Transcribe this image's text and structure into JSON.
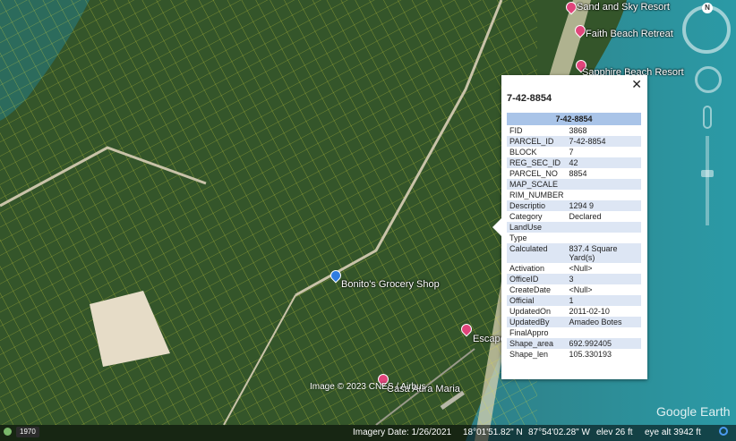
{
  "places": [
    {
      "name": "Sand and Sky Resort"
    },
    {
      "name": "Faith Beach Retreat"
    },
    {
      "name": "Sapphire Beach Resort"
    },
    {
      "name": "Bonito's Grocery Shop"
    },
    {
      "name": "Escape"
    },
    {
      "name": "Casa Aura Maria"
    }
  ],
  "popup": {
    "title": "7-42-8854",
    "close_symbol": "✕",
    "table_header": "7-42-8854",
    "rows": [
      {
        "k": "FID",
        "v": "3868"
      },
      {
        "k": "PARCEL_ID",
        "v": "7-42-8854"
      },
      {
        "k": "BLOCK",
        "v": "7"
      },
      {
        "k": "REG_SEC_ID",
        "v": "42"
      },
      {
        "k": "PARCEL_NO",
        "v": "8854"
      },
      {
        "k": "MAP_SCALE",
        "v": ""
      },
      {
        "k": "RIM_NUMBER",
        "v": ""
      },
      {
        "k": "Descriptio",
        "v": "1294 9"
      },
      {
        "k": "Category",
        "v": "Declared"
      },
      {
        "k": "LandUse",
        "v": ""
      },
      {
        "k": "Type",
        "v": ""
      },
      {
        "k": "Calculated",
        "v": "837.4 Square Yard(s)"
      },
      {
        "k": "Activation",
        "v": "<Null>"
      },
      {
        "k": "OfficeID",
        "v": "3"
      },
      {
        "k": "CreateDate",
        "v": "<Null>"
      },
      {
        "k": "Official",
        "v": "1"
      },
      {
        "k": "UpdatedOn",
        "v": "2011-02-10"
      },
      {
        "k": "UpdatedBy",
        "v": "Amadeo Botes"
      },
      {
        "k": "FinalAppro",
        "v": ""
      },
      {
        "k": "Shape_area",
        "v": "692.992405"
      },
      {
        "k": "Shape_len",
        "v": "105.330193"
      }
    ]
  },
  "controls": {
    "compass_letter": "N",
    "compass_icon": "compass-icon",
    "look_icon": "look-joystick-icon",
    "pegman_icon": "street-view-icon",
    "zoom_icon": "zoom-slider"
  },
  "copyright": "Image © 2023 CNES / Airbus",
  "watermark": "Google Earth",
  "status": {
    "year": "1970",
    "imagery_date": "Imagery Date: 1/26/2021",
    "lat": "18°01'51.82\" N",
    "lon": "87°54'02.28\" W",
    "elev": "elev    26 ft",
    "eye_alt": "eye alt   3942 ft"
  },
  "colors": {
    "parcel_lines": "#e6e23a",
    "land": "#3a5a2c",
    "water": "#2a8a95",
    "pin": "#e0457b",
    "table_header": "#a9c4e8"
  }
}
